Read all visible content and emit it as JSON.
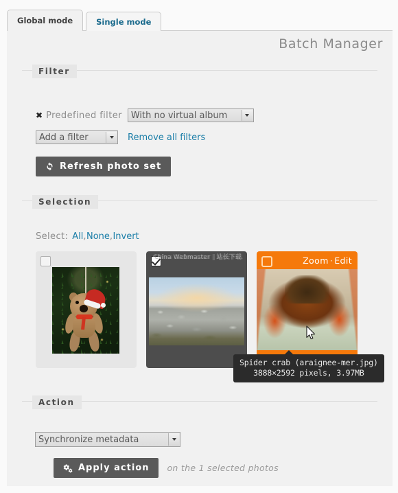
{
  "tabs": [
    {
      "label": "Global mode",
      "active": true
    },
    {
      "label": "Single mode",
      "active": false
    }
  ],
  "page_title": "Batch Manager",
  "filter": {
    "legend": "Filter",
    "remove_icon": "✖",
    "predefined_label": "Predefined filter",
    "predefined_value": "With no virtual album",
    "add_filter_value": "Add a filter",
    "remove_all_link": "Remove all filters",
    "refresh_button": "Refresh photo set"
  },
  "selection": {
    "legend": "Selection",
    "select_label": "Select:",
    "links": [
      "All",
      "None",
      "Invert"
    ],
    "separator": ", ",
    "thumbs": [
      {
        "state": "plain",
        "checked": false,
        "actions": ""
      },
      {
        "state": "sel-dark",
        "checked": true,
        "actions": "",
        "watermark": "China Webmaster | 站长下载"
      },
      {
        "state": "hover",
        "checked": false,
        "zoom_label": "Zoom",
        "dot": "·",
        "edit_label": "Edit"
      }
    ],
    "tooltip": {
      "line1": "Spider crab (araignee-mer.jpg)",
      "line2": "3888×2592 pixels, 3.97MB"
    }
  },
  "action": {
    "legend": "Action",
    "select_value": "Synchronize metadata",
    "apply_button": "Apply action",
    "note": "on the 1 selected photos"
  },
  "colors": {
    "accent_orange": "#f5790b",
    "link_blue": "#1b7ea8",
    "button_gray": "#5a5a5a",
    "panel_bg": "#f1f1f1",
    "thumb_selected": "#4d4d4d"
  }
}
